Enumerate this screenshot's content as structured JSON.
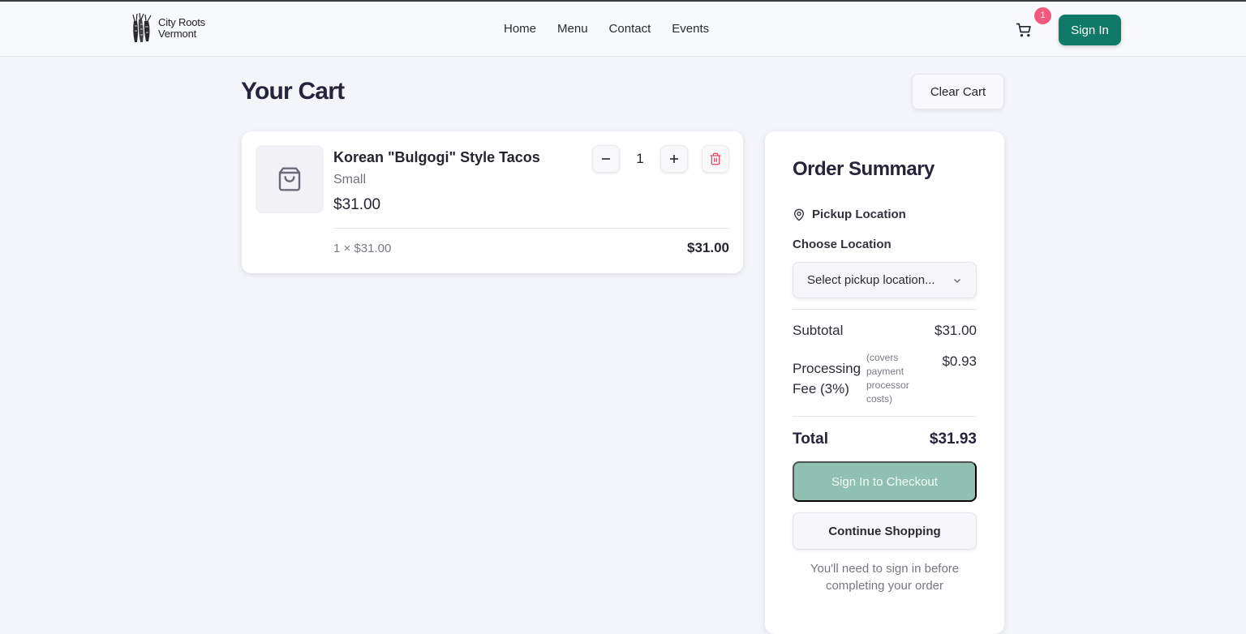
{
  "brand": {
    "line1": "City Roots",
    "line2": "Vermont"
  },
  "nav": {
    "items": [
      "Home",
      "Menu",
      "Contact",
      "Events"
    ]
  },
  "header": {
    "cart_count": "1",
    "signin_label": "Sign In"
  },
  "cart": {
    "title": "Your Cart",
    "clear_label": "Clear Cart",
    "items": [
      {
        "name": "Korean \"Bulgogi\" Style Tacos",
        "size": "Small",
        "price": "$31.00",
        "quantity": "1",
        "calc": "1 × $31.00",
        "line_total": "$31.00"
      }
    ]
  },
  "summary": {
    "title": "Order Summary",
    "pickup_label": "Pickup Location",
    "choose_label": "Choose Location",
    "select_placeholder": "Select pickup location...",
    "subtotal_label": "Subtotal",
    "subtotal_value": "$31.00",
    "fee_label": "Processing Fee (3%)",
    "fee_note": "(covers payment processor costs)",
    "fee_value": "$0.93",
    "total_label": "Total",
    "total_value": "$31.93",
    "checkout_label": "Sign In to Checkout",
    "continue_label": "Continue Shopping",
    "signin_note": "You'll need to sign in before completing your order"
  },
  "colors": {
    "brand_green": "#0f7a67",
    "checkout_disabled": "#8fc0b1",
    "badge_pink": "#f2597c",
    "delete_red": "#e5486b"
  }
}
